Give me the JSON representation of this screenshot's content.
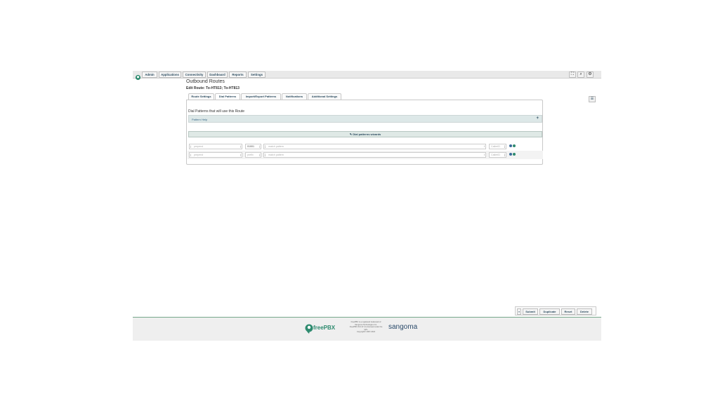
{
  "topnav": {
    "menu": [
      {
        "label": "Admin"
      },
      {
        "label": "Applications"
      },
      {
        "label": "Connectivity"
      },
      {
        "label": "Dashboard"
      },
      {
        "label": "Reports"
      },
      {
        "label": "Settings"
      }
    ],
    "tools": [
      {
        "icon": "language-icon",
        "glyph": "⛶"
      },
      {
        "icon": "search-icon",
        "glyph": "⌕"
      },
      {
        "icon": "gear-icon",
        "glyph": "⚙"
      }
    ]
  },
  "page": {
    "title": "Outbound Routes",
    "subtitle": "Edit Route: To-HT813; To-HT813"
  },
  "tabs": [
    {
      "label": "Route Settings",
      "active": false
    },
    {
      "label": "Dial Patterns",
      "active": true
    },
    {
      "label": "Import/Export Patterns",
      "active": false
    },
    {
      "label": "Notifications",
      "active": false
    },
    {
      "label": "Additional Settings",
      "active": false
    }
  ],
  "dial_patterns": {
    "heading": "Dial Patterns that will use this Route",
    "help_label": "Pattern Help",
    "help_toggle": "+",
    "wizard_label": "Dial patterns wizards",
    "rows": [
      {
        "prepend_placeholder": "prepend",
        "prefix_value": "01001",
        "match_placeholder": "match pattern",
        "callerid_placeholder": "CallerID"
      },
      {
        "prepend_placeholder": "prepend",
        "prefix_placeholder": "prefix",
        "match_placeholder": "match pattern",
        "callerid_placeholder": "CallerID"
      }
    ]
  },
  "actions": {
    "toggle": "»",
    "submit": "Submit",
    "duplicate": "Duplicate",
    "reset": "Reset",
    "delete": "Delete"
  },
  "footer": {
    "brand": "freePBX",
    "legal_lines": [
      "FreePBX is a registered trademark of",
      "Sangoma Technologies Inc.",
      "FreePBX 15.0.37.4 is licensed under the",
      "GPL",
      "Copyright© 2007-2024"
    ],
    "partner": "sangoma"
  },
  "colors": {
    "accent": "#2e8b6f",
    "nav_text": "#2a4a5e",
    "help_bar": "#dde8e8"
  }
}
